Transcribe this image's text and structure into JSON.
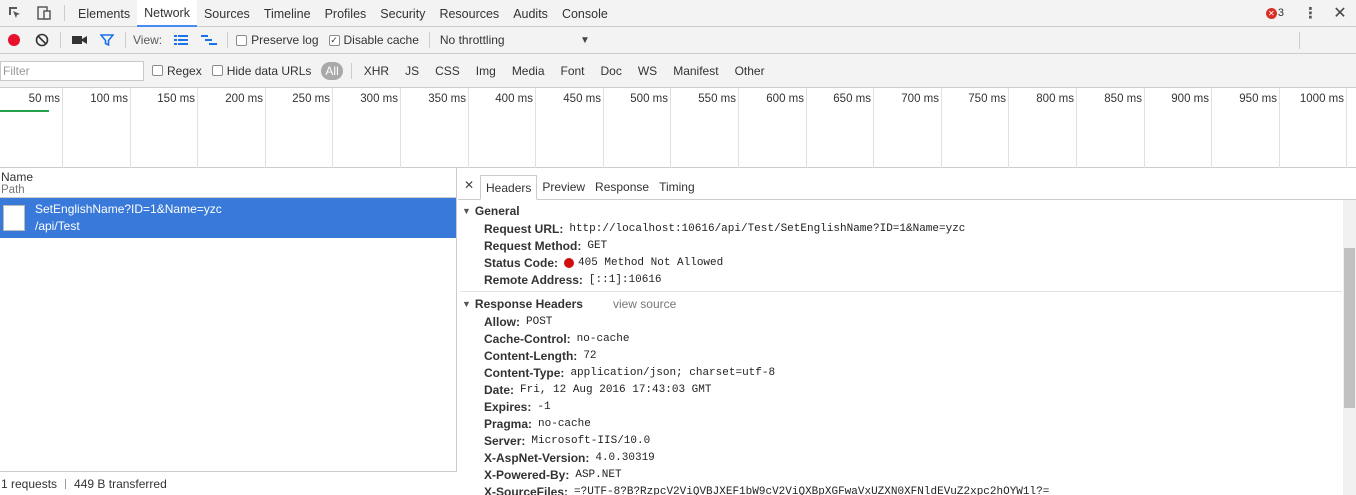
{
  "tabs": [
    "Elements",
    "Network",
    "Sources",
    "Timeline",
    "Profiles",
    "Security",
    "Resources",
    "Audits",
    "Console"
  ],
  "active_tab": "Network",
  "error_count": "3",
  "toolbar": {
    "view_label": "View:",
    "preserve_log": "Preserve log",
    "disable_cache": "Disable cache",
    "throttling": "No throttling"
  },
  "filter": {
    "placeholder": "Filter",
    "regex": "Regex",
    "hide_data_urls": "Hide data URLs",
    "types": [
      "All",
      "XHR",
      "JS",
      "CSS",
      "Img",
      "Media",
      "Font",
      "Doc",
      "WS",
      "Manifest",
      "Other"
    ]
  },
  "overview_ticks": [
    "50 ms",
    "100 ms",
    "150 ms",
    "200 ms",
    "250 ms",
    "300 ms",
    "350 ms",
    "400 ms",
    "450 ms",
    "500 ms",
    "550 ms",
    "600 ms",
    "650 ms",
    "700 ms",
    "750 ms",
    "800 ms",
    "850 ms",
    "900 ms",
    "950 ms",
    "1000 ms"
  ],
  "request_list": {
    "col_name": "Name",
    "col_path": "Path",
    "requests": [
      {
        "name": "SetEnglishName?ID=1&Name=yzc",
        "path": "/api/Test"
      }
    ],
    "summary_requests": "1 requests",
    "summary_transferred": "449 B transferred"
  },
  "detail": {
    "tabs": [
      "Headers",
      "Preview",
      "Response",
      "Timing"
    ],
    "general_title": "General",
    "general": [
      {
        "key": "Request URL:",
        "value": "http://localhost:10616/api/Test/SetEnglishName?ID=1&Name=yzc"
      },
      {
        "key": "Request Method:",
        "value": "GET"
      },
      {
        "key": "Status Code:",
        "value": "405 Method Not Allowed"
      },
      {
        "key": "Remote Address:",
        "value": "[::1]:10616"
      }
    ],
    "response_title": "Response Headers",
    "view_source": "view source",
    "response": [
      {
        "key": "Allow:",
        "value": "POST"
      },
      {
        "key": "Cache-Control:",
        "value": "no-cache"
      },
      {
        "key": "Content-Length:",
        "value": "72"
      },
      {
        "key": "Content-Type:",
        "value": "application/json; charset=utf-8"
      },
      {
        "key": "Date:",
        "value": "Fri, 12 Aug 2016 17:43:03 GMT"
      },
      {
        "key": "Expires:",
        "value": "-1"
      },
      {
        "key": "Pragma:",
        "value": "no-cache"
      },
      {
        "key": "Server:",
        "value": "Microsoft-IIS/10.0"
      },
      {
        "key": "X-AspNet-Version:",
        "value": "4.0.30319"
      },
      {
        "key": "X-Powered-By:",
        "value": "ASP.NET"
      },
      {
        "key": "X-SourceFiles:",
        "value": "=?UTF-8?B?RzpcV2ViQVBJXEF1bW9cV2ViQXBpXGFwaVxUZXN0XFNldEVuZ2xpc2hOYW1l?="
      }
    ]
  },
  "colors": {
    "accent": "#3879d9",
    "record": "#e8112d",
    "error": "#d0100f"
  }
}
